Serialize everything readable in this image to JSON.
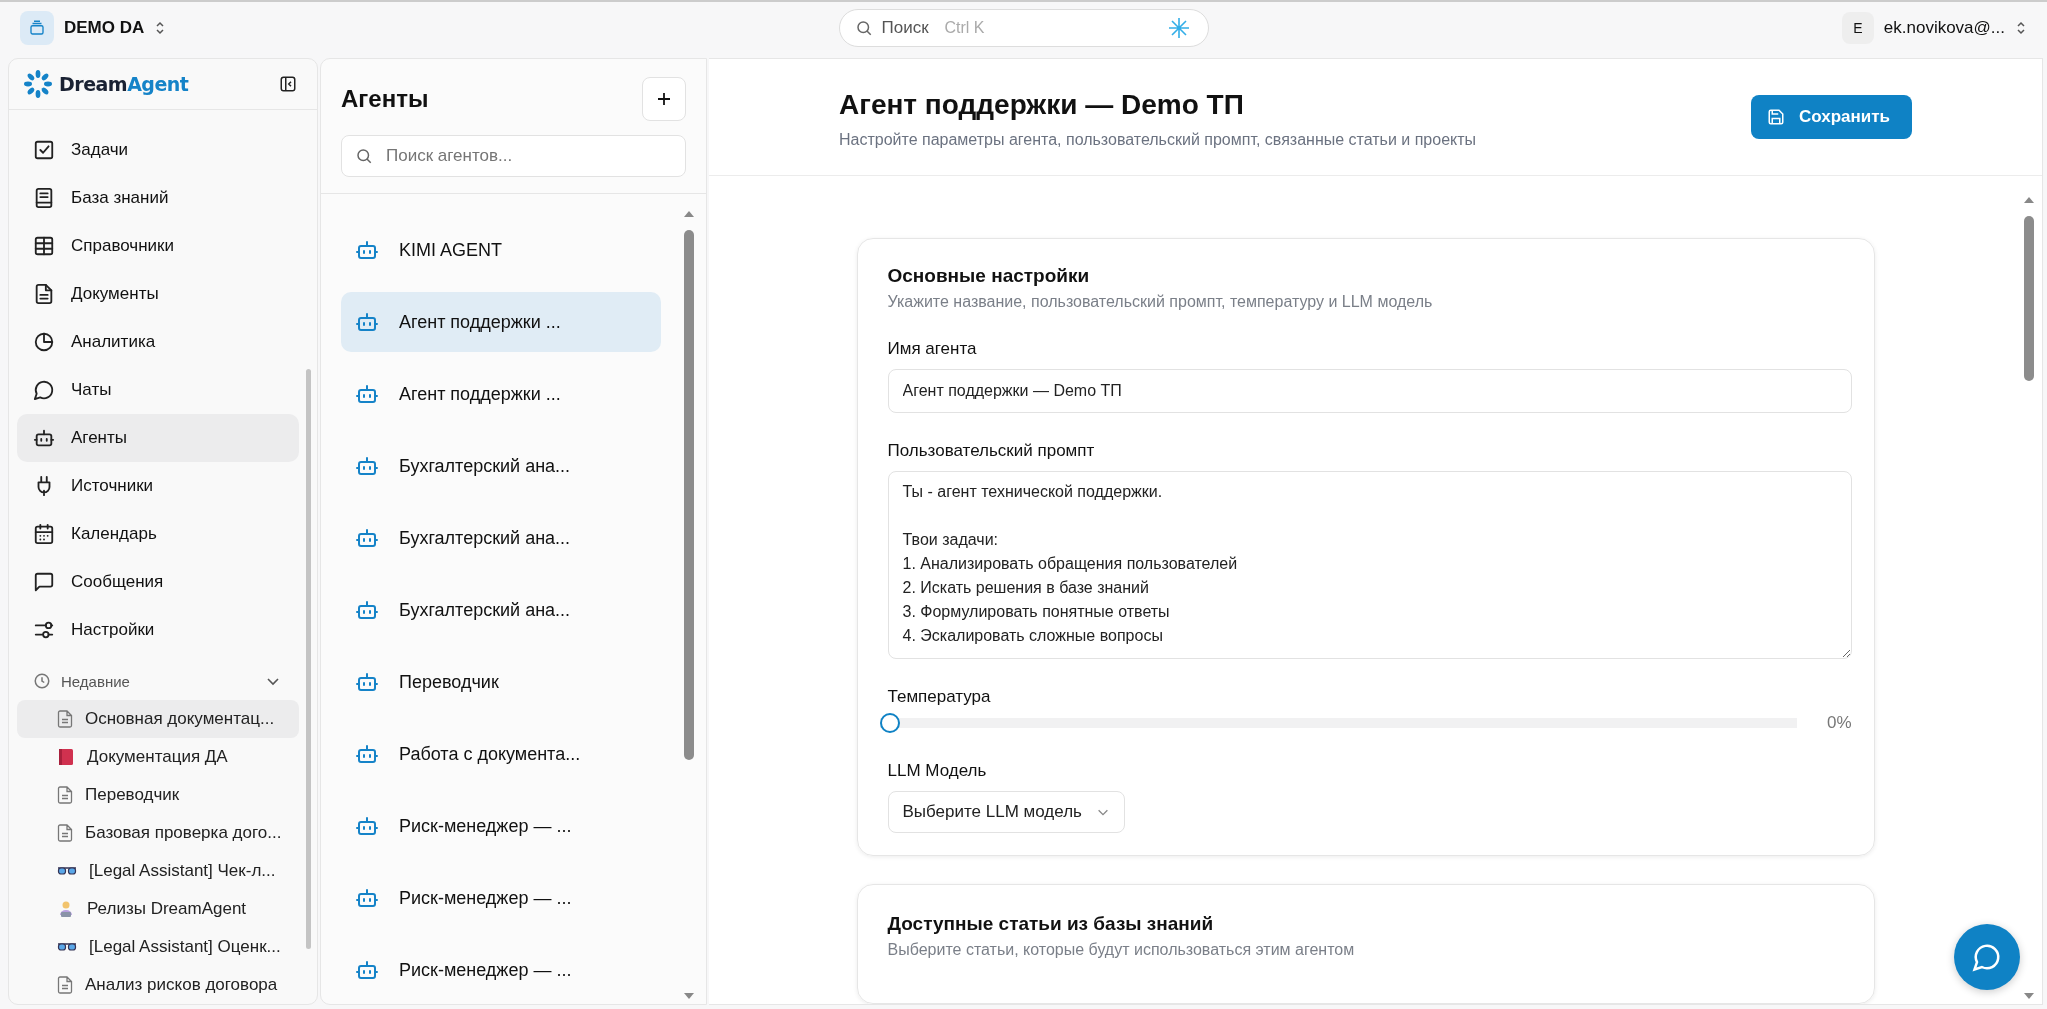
{
  "topbar": {
    "workspace": "DEMO DA",
    "search": {
      "placeholder": "Поиск",
      "shortcut": "Ctrl K"
    },
    "user": {
      "initial": "E",
      "name": "ek.novikova@..."
    }
  },
  "sidebar": {
    "logo": {
      "part1": "Dream",
      "part2": "Agent"
    },
    "items": [
      {
        "label": "Задачи",
        "selected": false
      },
      {
        "label": "База знаний",
        "selected": false
      },
      {
        "label": "Справочники",
        "selected": false
      },
      {
        "label": "Документы",
        "selected": false
      },
      {
        "label": "Аналитика",
        "selected": false
      },
      {
        "label": "Чаты",
        "selected": false
      },
      {
        "label": "Агенты",
        "selected": true
      },
      {
        "label": "Источники",
        "selected": false
      },
      {
        "label": "Календарь",
        "selected": false
      },
      {
        "label": "Сообщения",
        "selected": false
      },
      {
        "label": "Настройки",
        "selected": false
      }
    ],
    "recent": {
      "title": "Недавние",
      "expanded": true,
      "items": [
        {
          "label": "Основная документац...",
          "kind": "document",
          "selected": true
        },
        {
          "label": "Документация ДА",
          "kind": "book",
          "selected": false
        },
        {
          "label": "Переводчик",
          "kind": "document",
          "selected": false
        },
        {
          "label": "Базовая проверка дого...",
          "kind": "document",
          "selected": false
        },
        {
          "label": "[Legal Assistant] Чек-л...",
          "kind": "glasses",
          "selected": false
        },
        {
          "label": "Релизы DreamAgent",
          "kind": "person",
          "selected": false
        },
        {
          "label": "[Legal Assistant] Оценк...",
          "kind": "glasses",
          "selected": false
        },
        {
          "label": "Анализ рисков договора",
          "kind": "document",
          "selected": false
        }
      ]
    }
  },
  "agents": {
    "title": "Агенты",
    "search": {
      "placeholder": "Поиск агентов..."
    },
    "items": [
      {
        "label": "KIMI AGENT",
        "selected": false
      },
      {
        "label": "Агент поддержки ...",
        "selected": true
      },
      {
        "label": "Агент поддержки ...",
        "selected": false
      },
      {
        "label": "Бухгалтерский ана...",
        "selected": false
      },
      {
        "label": "Бухгалтерский ана...",
        "selected": false
      },
      {
        "label": "Бухгалтерский ана...",
        "selected": false
      },
      {
        "label": "Переводчик",
        "selected": false
      },
      {
        "label": "Работа с документа...",
        "selected": false
      },
      {
        "label": "Риск-менеджер — ...",
        "selected": false
      },
      {
        "label": "Риск-менеджер — ...",
        "selected": false
      },
      {
        "label": "Риск-менеджер — ...",
        "selected": false
      }
    ]
  },
  "page": {
    "title": "Агент поддержки — Demo ТП",
    "subtitle": "Настройте параметры агента, пользовательский промпт, связанные статьи и проекты",
    "save_button": "Сохранить"
  },
  "basic_settings": {
    "title": "Основные настройки",
    "subtitle": "Укажите название, пользовательский промпт, температуру и LLM модель",
    "name_label": "Имя агента",
    "name_value": "Агент поддержки — Demo ТП",
    "prompt_label": "Пользовательский промпт",
    "prompt_value": "Ты - агент технической поддержки.\n\nТвои задачи:\n1. Анализировать обращения пользователей\n2. Искать решения в базе знаний\n3. Формулировать понятные ответы\n4. Эскалировать сложные вопросы",
    "temperature_label": "Температура",
    "temperature": {
      "level": 0,
      "reading": "0%"
    },
    "model_label": "LLM Модель",
    "model_placeholder": "Выберите LLM модель"
  },
  "articles": {
    "title": "Доступные статьи из базы знаний",
    "subtitle": "Выберите статьи, которые будут использоваться этим агентом"
  }
}
